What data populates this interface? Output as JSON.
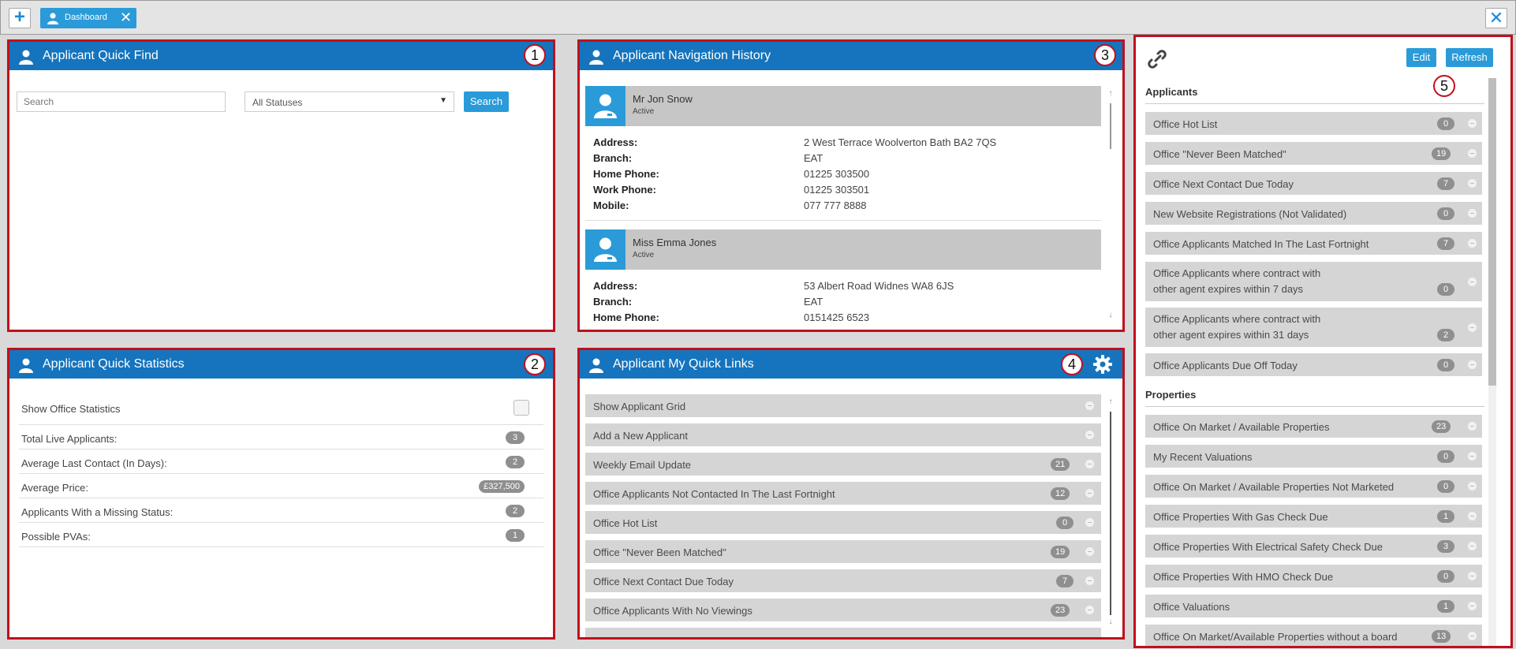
{
  "topbar": {
    "tab_label": "Dashboard",
    "add_glyph": "+",
    "close_glyph": "✕"
  },
  "colors": {
    "accent": "#2a9bd8",
    "header": "#1574bd",
    "highlight": "#c0101c"
  },
  "icons": [
    "plus-icon",
    "user-icon",
    "close-icon",
    "link-icon",
    "gear-icon",
    "chevron-down-icon",
    "go-icon"
  ],
  "panel1": {
    "title": "Applicant Quick Find",
    "marker": "1",
    "search_placeholder": "Search",
    "status_select": "All Statuses",
    "search_button": "Search"
  },
  "panel2": {
    "title": "Applicant Quick Statistics",
    "marker": "2",
    "show_office_label": "Show Office Statistics",
    "show_office_checked": false,
    "stats": [
      {
        "label": "Total Live Applicants:",
        "value": "3"
      },
      {
        "label": "Average Last Contact (In Days):",
        "value": "2"
      },
      {
        "label": "Average Price:",
        "value": "£327,500"
      },
      {
        "label": "Applicants With a Missing Status:",
        "value": "2"
      },
      {
        "label": "Possible PVAs:",
        "value": "1"
      }
    ]
  },
  "panel3": {
    "title": "Applicant Navigation History",
    "marker": "3",
    "applicants": [
      {
        "name": "Mr Jon Snow",
        "status": "Active",
        "fields": [
          {
            "label": "Address:",
            "value": "2 West Terrace Woolverton Bath BA2 7QS"
          },
          {
            "label": "Branch:",
            "value": "EAT"
          },
          {
            "label": "Home Phone:",
            "value": "01225 303500"
          },
          {
            "label": "Work Phone:",
            "value": "01225 303501"
          },
          {
            "label": "Mobile:",
            "value": "077 777 8888"
          }
        ]
      },
      {
        "name": "Miss Emma Jones",
        "status": "Active",
        "fields": [
          {
            "label": "Address:",
            "value": "53 Albert Road Widnes WA8 6JS"
          },
          {
            "label": "Branch:",
            "value": "EAT"
          },
          {
            "label": "Home Phone:",
            "value": "0151425 6523"
          }
        ]
      }
    ]
  },
  "panel4": {
    "title": "Applicant My Quick Links",
    "marker": "4",
    "links": [
      {
        "label": "Show Applicant Grid",
        "count": ""
      },
      {
        "label": "Add a New Applicant",
        "count": ""
      },
      {
        "label": "Weekly Email Update",
        "count": "21"
      },
      {
        "label": "Office Applicants Not Contacted In The Last Fortnight",
        "count": "12"
      },
      {
        "label": "Office Hot List",
        "count": "0"
      },
      {
        "label": "Office \"Never Been Matched\"",
        "count": "19"
      },
      {
        "label": "Office Next Contact Due Today",
        "count": "7"
      },
      {
        "label": "Office Applicants With No Viewings",
        "count": "23"
      }
    ]
  },
  "panel5": {
    "marker": "5",
    "edit_button": "Edit",
    "refresh_button": "Refresh",
    "applicants_heading": "Applicants",
    "applicants": [
      {
        "label": "Office Hot List",
        "count": "0"
      },
      {
        "label": "Office \"Never Been Matched\"",
        "count": "19"
      },
      {
        "label": "Office Next Contact Due Today",
        "count": "7"
      },
      {
        "label": "New Website Registrations (Not Validated)",
        "count": "0"
      },
      {
        "label": "Office Applicants Matched In The Last Fortnight",
        "count": "7"
      },
      {
        "label": "Office Applicants where contract with",
        "label2": "other agent expires within 7 days",
        "count": "0"
      },
      {
        "label": "Office Applicants where contract with",
        "label2": "other agent expires within 31 days",
        "count": "2"
      },
      {
        "label": "Office Applicants Due Off Today",
        "count": "0"
      }
    ],
    "properties_heading": "Properties",
    "properties": [
      {
        "label": "Office On Market / Available Properties",
        "count": "23"
      },
      {
        "label": "My Recent Valuations",
        "count": "0"
      },
      {
        "label": "Office On Market / Available Properties Not Marketed",
        "count": "0"
      },
      {
        "label": "Office Properties With Gas Check Due",
        "count": "1"
      },
      {
        "label": "Office Properties With Electrical Safety Check Due",
        "count": "3"
      },
      {
        "label": "Office Properties With HMO Check Due",
        "count": "0"
      },
      {
        "label": "Office Valuations",
        "count": "1"
      },
      {
        "label": "Office On Market/Available Properties without a board",
        "count": "13"
      }
    ]
  }
}
